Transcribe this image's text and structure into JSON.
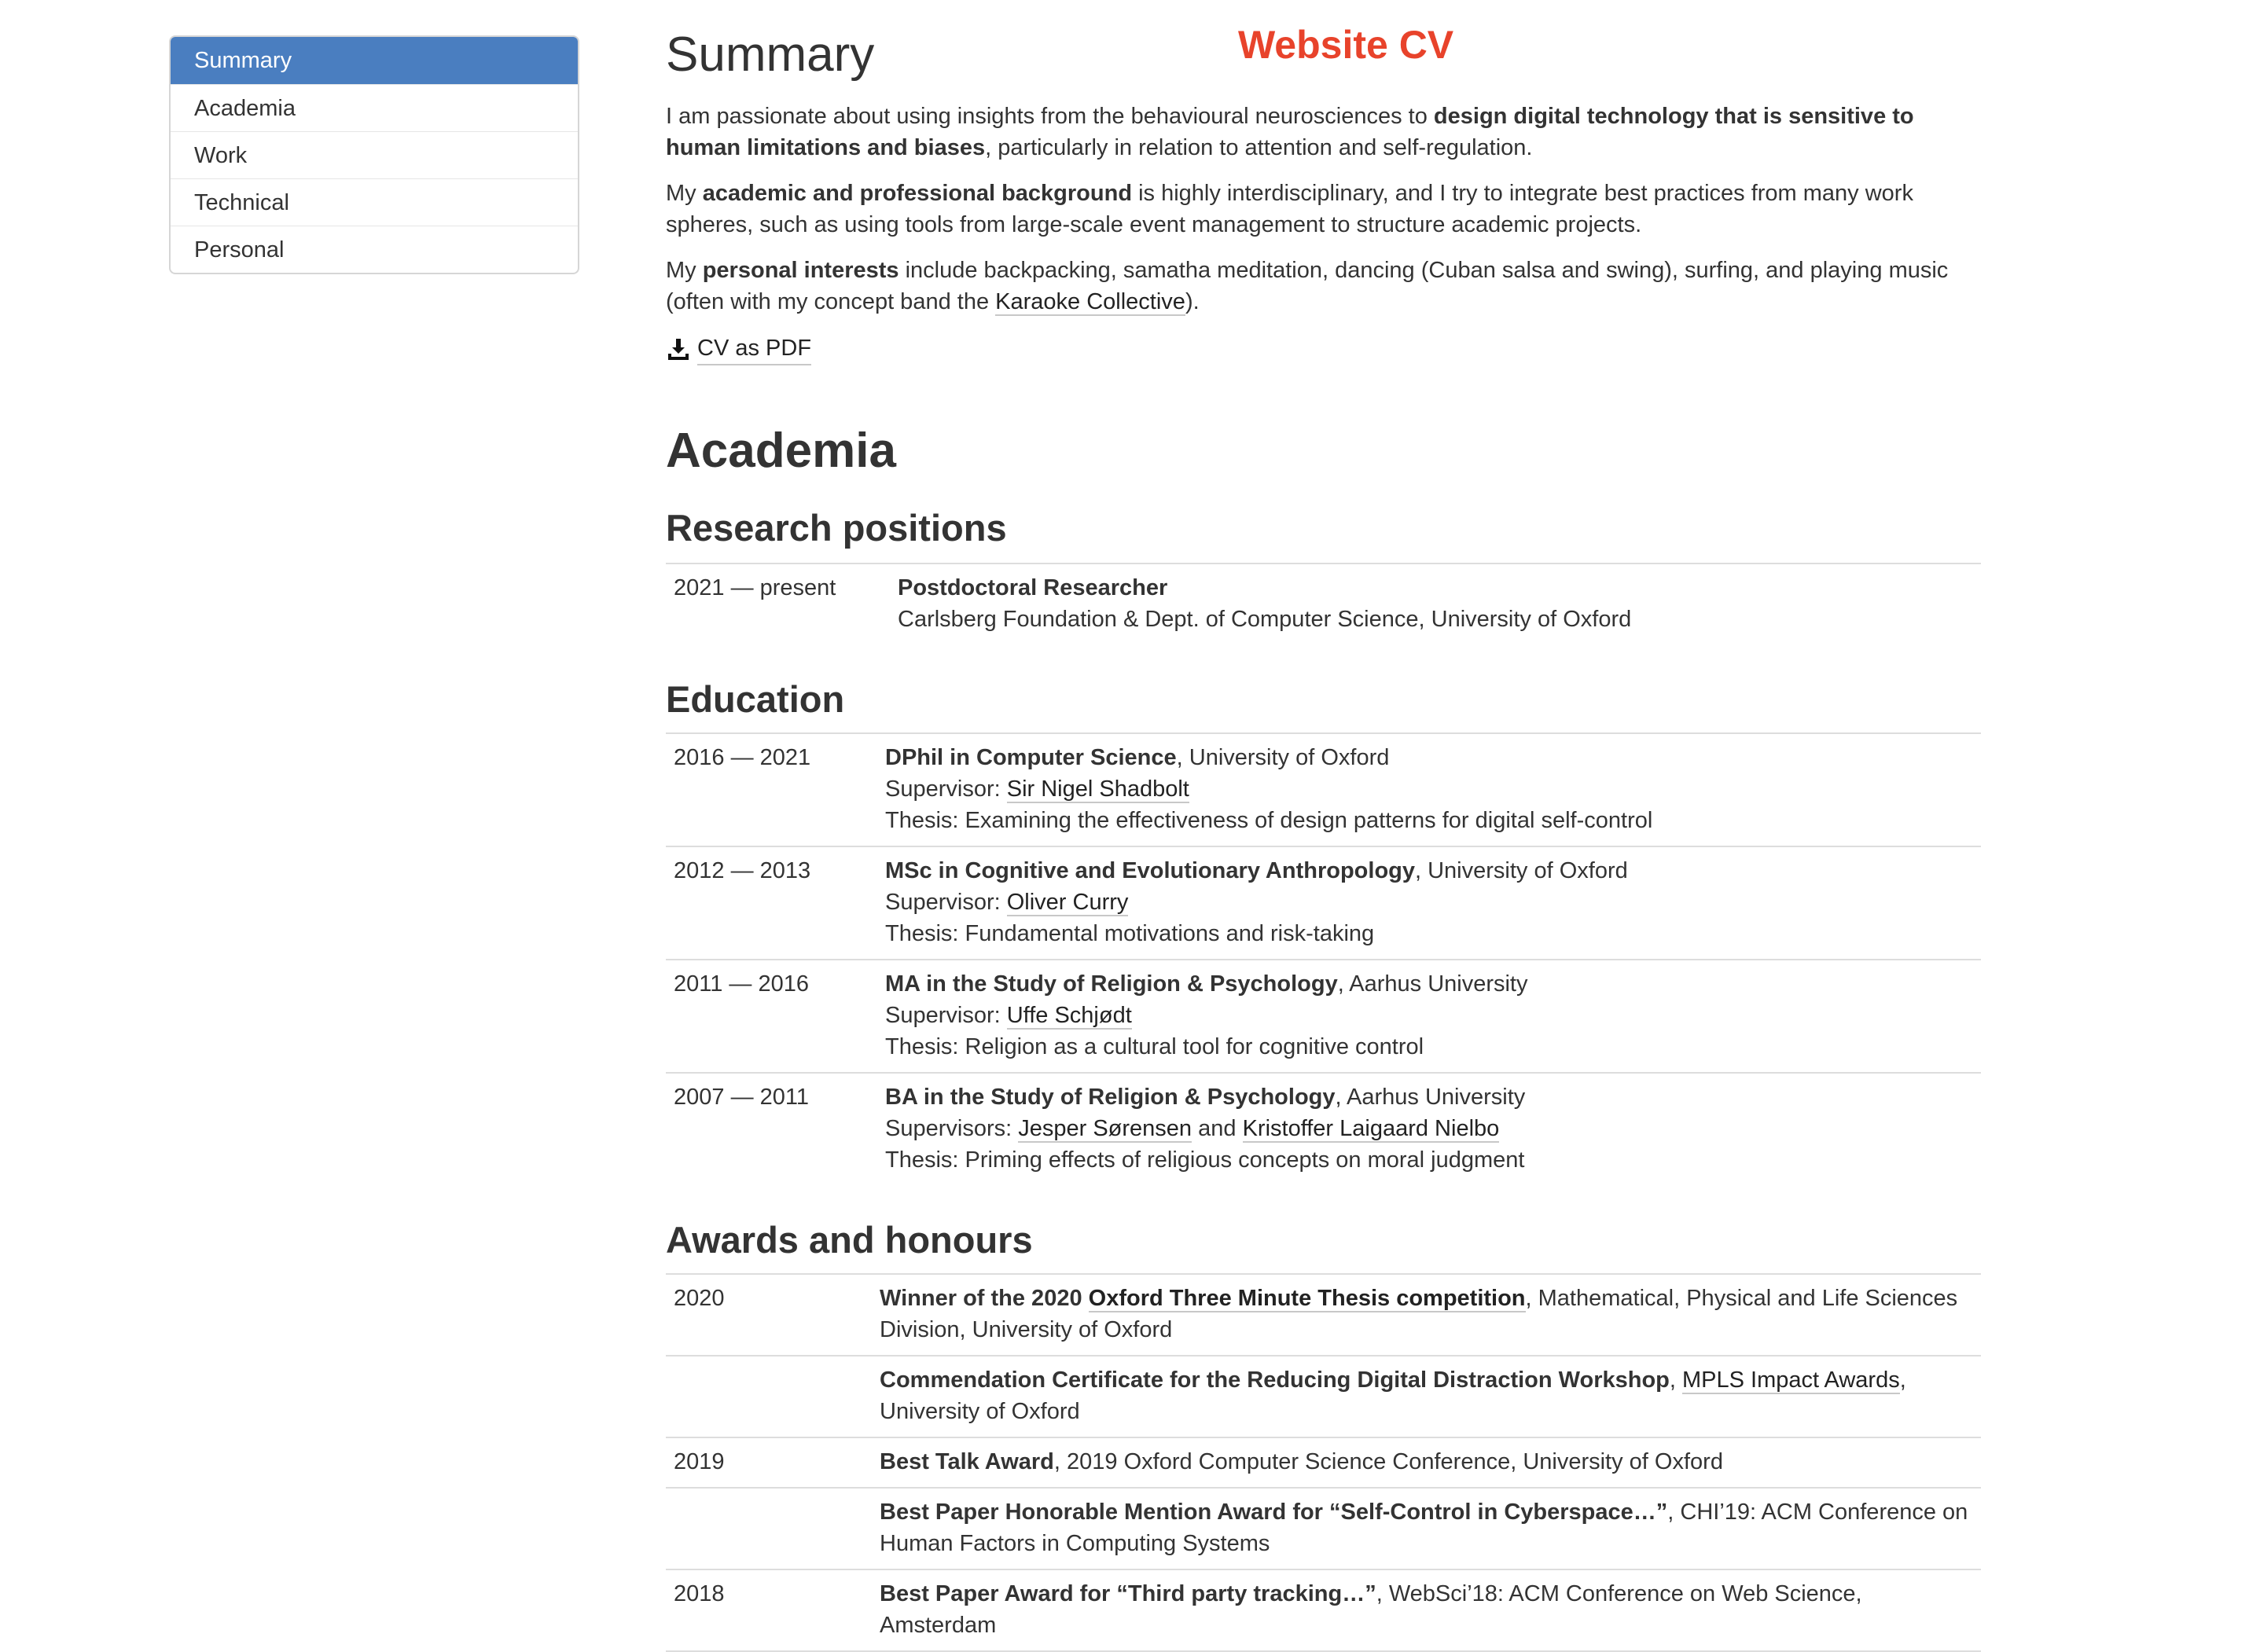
{
  "page_tag": "Website CV",
  "nav": [
    "Summary",
    "Academia",
    "Work",
    "Technical",
    "Personal"
  ],
  "summary": {
    "title": "Summary",
    "p1": [
      "I am passionate about using insights from the behavioural neurosciences to ",
      "design digital technology that is sensitive to human limitations and biases",
      ", particularly in relation to attention and self-regulation."
    ],
    "p2": [
      "My ",
      "academic and professional background",
      " is highly interdisciplinary, and I try to integrate best practices from many work spheres, such as using tools from large-scale event management to structure academic projects."
    ],
    "p3": [
      "My ",
      "personal interests",
      " include backpacking, samatha meditation, dancing (Cuban salsa and swing), surfing, and playing music (often with my concept band the ",
      "Karaoke Collective",
      ")."
    ],
    "pdf_link": "CV as PDF"
  },
  "academia": {
    "title": "Academia",
    "research": {
      "title": "Research positions",
      "rows": [
        {
          "date": "2021 — present",
          "role": "Postdoctoral Researcher",
          "org": "Carlsberg Foundation & Dept. of Computer Science, University of Oxford"
        }
      ]
    },
    "education": {
      "title": "Education",
      "rows": [
        {
          "date": "2016 — 2021",
          "degree": "DPhil in Computer Science",
          "inst": ", University of Oxford",
          "sup_label": "Supervisor: ",
          "sup1": "Sir Nigel Shadbolt",
          "sup_and": "",
          "sup2": "",
          "thesis": "Thesis: Examining the effectiveness of design patterns for digital self-control"
        },
        {
          "date": "2012 — 2013",
          "degree": "MSc in Cognitive and Evolutionary Anthropology",
          "inst": ", University of Oxford",
          "sup_label": "Supervisor: ",
          "sup1": "Oliver Curry",
          "sup_and": "",
          "sup2": "",
          "thesis": "Thesis: Fundamental motivations and risk-taking"
        },
        {
          "date": "2011 — 2016",
          "degree": "MA in the Study of Religion & Psychology",
          "inst": ", Aarhus University",
          "sup_label": "Supervisor: ",
          "sup1": "Uffe Schjødt",
          "sup_and": "",
          "sup2": "",
          "thesis": "Thesis: Religion as a cultural tool for cognitive control"
        },
        {
          "date": "2007 — 2011",
          "degree": "BA in the Study of Religion & Psychology",
          "inst": ", Aarhus University",
          "sup_label": "Supervisors: ",
          "sup1": "Jesper Sørensen",
          "sup_and": " and ",
          "sup2": "Kristoffer Laigaard Nielbo",
          "thesis": "Thesis: Priming effects of religious concepts on moral judgment"
        }
      ]
    },
    "awards": {
      "title": "Awards and honours",
      "a1": {
        "date": "2020",
        "b1": "Winner of the 2020 ",
        "link": "Oxford Three Minute Thesis competition",
        "rest": ", Mathematical, Physical and Life Sciences Division, University of Oxford"
      },
      "a2": {
        "date": "",
        "b1": "Commendation Certificate for the Reducing Digital Distraction Workshop",
        "sep": ", ",
        "link": "MPLS Impact Awards",
        "rest": ", University of Oxford"
      },
      "a3": {
        "date": "2019",
        "b1": "Best Talk Award",
        "rest": ", 2019 Oxford Computer Science Conference, University of Oxford"
      },
      "a4": {
        "date": "",
        "b1": "Best Paper Honorable Mention Award for “Self-Control in Cyberspace…”",
        "rest": ", CHI’19: ACM Conference on Human Factors in Computing Systems"
      },
      "a5": {
        "date": "2018",
        "b1": "Best Paper Award for “Third party tracking…”",
        "rest": ", WebSci’18: ACM Conference on Web Science, Amsterdam"
      }
    }
  },
  "colors": {
    "accent": "#4a7ec0",
    "tag": "#e8432b"
  }
}
